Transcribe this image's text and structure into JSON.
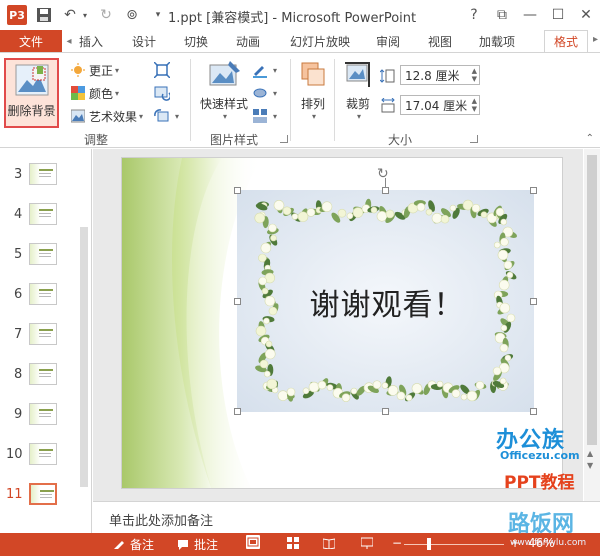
{
  "app": {
    "title": "1.ppt [兼容模式] - Microsoft PowerPoint",
    "logo": "P3"
  },
  "window_controls": {
    "help": "?",
    "restore_ribbon": "⧉",
    "minimize": "—",
    "maximize": "☐",
    "close": "✕"
  },
  "tabs": {
    "file": "文件",
    "items": [
      "插入",
      "设计",
      "切换",
      "动画",
      "幻灯片放映",
      "审阅",
      "视图",
      "加载项",
      "格式"
    ],
    "active": "格式"
  },
  "ribbon": {
    "adjust": {
      "remove_bg": "删除背景",
      "corrections": "更正",
      "color": "颜色",
      "artistic": "艺术效果",
      "label": "调整"
    },
    "picture_styles": {
      "quick_styles": "快速样式",
      "label": "图片样式"
    },
    "arrange": {
      "label": "排列"
    },
    "size": {
      "crop": "裁剪",
      "height": "12.8 厘米",
      "width": "17.04 厘米",
      "label": "大小"
    }
  },
  "slides": {
    "items": [
      {
        "num": "3"
      },
      {
        "num": "4"
      },
      {
        "num": "5"
      },
      {
        "num": "6"
      },
      {
        "num": "7"
      },
      {
        "num": "8"
      },
      {
        "num": "9"
      },
      {
        "num": "10"
      },
      {
        "num": "11"
      }
    ],
    "selected": "11"
  },
  "slide": {
    "text": "谢谢观看！"
  },
  "notes": {
    "placeholder": "单击此处添加备注"
  },
  "statusbar": {
    "notes": "备注",
    "comments": "批注",
    "zoom": "46%",
    "zoom_value": 0.46
  },
  "watermark": {
    "brand": "办公族",
    "site": "Officezu.com",
    "tutorial": "PPT教程",
    "brand2": "路饭网",
    "site2": "www.fanwlu.com"
  },
  "colors": {
    "accent": "#d24726",
    "selected_border": "#e14b4b"
  }
}
